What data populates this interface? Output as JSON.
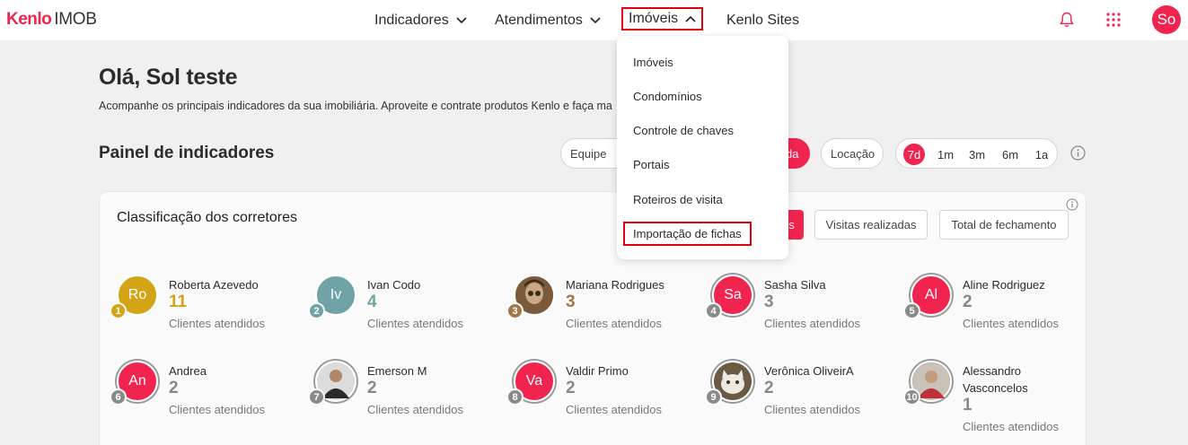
{
  "header": {
    "logo_brand": "Kenlo",
    "logo_product": "IMOB",
    "nav": [
      {
        "label": "Indicadores",
        "icon": "chevron-down-icon"
      },
      {
        "label": "Atendimentos",
        "icon": "chevron-down-icon"
      },
      {
        "label": "Imóveis",
        "icon": "chevron-up-icon"
      },
      {
        "label": "Kenlo Sites"
      }
    ],
    "icons": [
      "bell-icon",
      "apps-grid-icon"
    ],
    "avatar": "So",
    "accent_color": "#f0244f"
  },
  "dropdown": {
    "items": [
      "Imóveis",
      "Condomínios",
      "Controle de chaves",
      "Portais",
      "Roteiros de visita",
      "Importação de fichas"
    ]
  },
  "main": {
    "greeting": "Olá, Sol teste",
    "subtitle": "Acompanhe os principais indicadores da sua imobiliária. Aproveite e contrate produtos Kenlo e faça ma",
    "panel_title": "Painel de indicadores",
    "filters": {
      "team": "Equipe",
      "sale_fragment": "da",
      "rent": "Locação",
      "ranges": [
        "7d",
        "1m",
        "3m",
        "6m",
        "1a"
      ],
      "selected_range": "7d"
    }
  },
  "ranking": {
    "title": "Classificação dos corretores",
    "tabs": [
      "s",
      "Visitas realizadas",
      "Total de fechamento"
    ],
    "agents": [
      {
        "rank": "1",
        "initials": "Ro",
        "name": "Roberta Azevedo",
        "count": "11",
        "label": "Clientes atendidos",
        "color": "#d4a417"
      },
      {
        "rank": "2",
        "initials": "Iv",
        "name": "Ivan Codo",
        "count": "4",
        "label": "Clientes atendidos",
        "color": "#6fa3a6"
      },
      {
        "rank": "3",
        "initials": "",
        "name": "Mariana Rodrigues",
        "count": "3",
        "label": "Clientes atendidos",
        "color": "#a0784a"
      },
      {
        "rank": "4",
        "initials": "Sa",
        "name": "Sasha Silva",
        "count": "3",
        "label": "Clientes atendidos",
        "color": "#f0244f"
      },
      {
        "rank": "5",
        "initials": "Al",
        "name": "Aline Rodriguez",
        "count": "2",
        "label": "Clientes atendidos",
        "color": "#f0244f"
      },
      {
        "rank": "6",
        "initials": "An",
        "name": "Andrea",
        "count": "2",
        "label": "Clientes atendidos",
        "color": "#f0244f"
      },
      {
        "rank": "7",
        "initials": "",
        "name": "Emerson M",
        "count": "2",
        "label": "Clientes atendidos",
        "color": "#555555"
      },
      {
        "rank": "8",
        "initials": "Va",
        "name": "Valdir Primo",
        "count": "2",
        "label": "Clientes atendidos",
        "color": "#f0244f"
      },
      {
        "rank": "9",
        "initials": "",
        "name": "Verônica OliveirA",
        "count": "2",
        "label": "Clientes atendidos",
        "color": "#b9a68a"
      },
      {
        "rank": "10",
        "initials": "",
        "name": "Alessandro Vasconcelos",
        "count": "1",
        "label": "Clientes atendidos",
        "color": "#b04040"
      }
    ]
  }
}
